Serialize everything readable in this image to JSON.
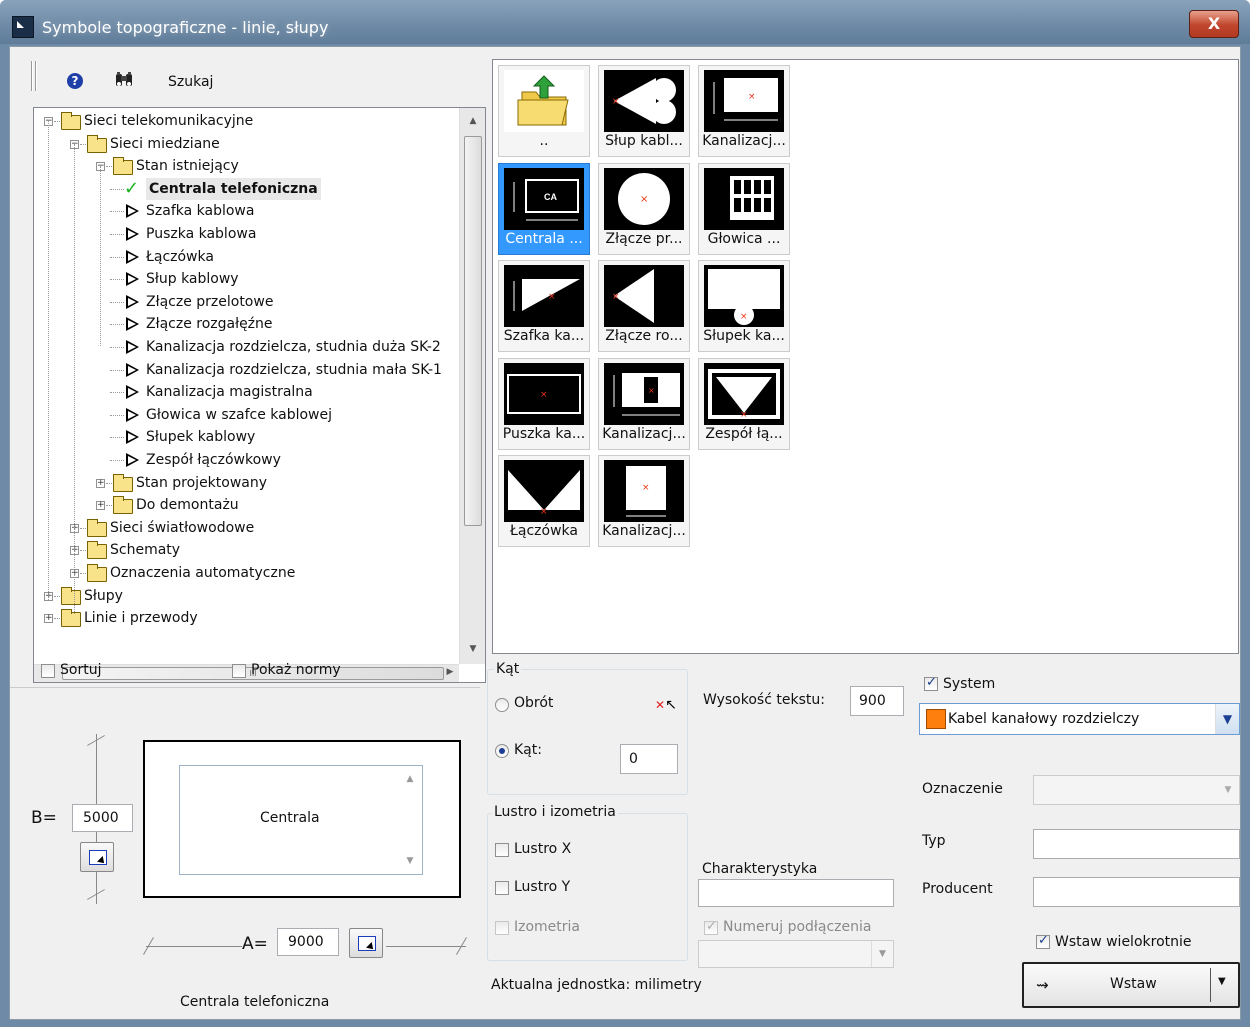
{
  "window": {
    "title": "Symbole topograficzne - linie, słupy",
    "close_label": "X"
  },
  "toolbar": {
    "search_label": "Szukaj",
    "help_label": "?"
  },
  "tree": {
    "items": [
      {
        "label": "Sieci telekomunikacyjne",
        "type": "folder",
        "expanded": true
      },
      {
        "label": "Sieci miedziane",
        "type": "folder",
        "expanded": true
      },
      {
        "label": "Stan istniejący",
        "type": "folder",
        "expanded": true
      },
      {
        "label": "Centrala telefoniczna",
        "type": "symbol",
        "selected": true
      },
      {
        "label": "Szafka kablowa",
        "type": "symbol"
      },
      {
        "label": "Puszka kablowa",
        "type": "symbol"
      },
      {
        "label": "Łączówka",
        "type": "symbol"
      },
      {
        "label": "Słup kablowy",
        "type": "symbol"
      },
      {
        "label": "Złącze przelotowe",
        "type": "symbol"
      },
      {
        "label": "Złącze rozgałęźne",
        "type": "symbol"
      },
      {
        "label": "Kanalizacja rozdzielcza, studnia duża SK-2",
        "type": "symbol"
      },
      {
        "label": "Kanalizacja rozdzielcza, studnia mała SK-1",
        "type": "symbol"
      },
      {
        "label": "Kanalizacja magistralna",
        "type": "symbol"
      },
      {
        "label": "Głowica w szafce kablowej",
        "type": "symbol"
      },
      {
        "label": "Słupek kablowy",
        "type": "symbol"
      },
      {
        "label": "Zespół łączówkowy",
        "type": "symbol"
      },
      {
        "label": "Stan projektowany",
        "type": "folder"
      },
      {
        "label": "Do demontażu",
        "type": "folder"
      },
      {
        "label": "Sieci światłowodowe",
        "type": "folder"
      },
      {
        "label": "Schematy",
        "type": "folder"
      },
      {
        "label": "Oznaczenia automatyczne",
        "type": "folder"
      },
      {
        "label": "Słupy",
        "type": "folder"
      },
      {
        "label": "Linie i przewody",
        "type": "folder"
      }
    ],
    "hscroll_glyph": "III"
  },
  "gallery": {
    "tiles": [
      {
        "caption": "..",
        "icon": "folder-up-icon"
      },
      {
        "caption": "Słup kabl...",
        "icon": "slup-icon"
      },
      {
        "caption": "Kanalizacj...",
        "icon": "kanalizacja-icon"
      },
      {
        "caption": "Centrala ...",
        "icon": "centrala-icon",
        "selected": true
      },
      {
        "caption": "Złącze pr...",
        "icon": "zlacze-przelotowe-icon"
      },
      {
        "caption": "Głowica ...",
        "icon": "glowica-icon"
      },
      {
        "caption": "Szafka ka...",
        "icon": "szafka-icon"
      },
      {
        "caption": "Złącze ro...",
        "icon": "zlacze-rozgalezne-icon"
      },
      {
        "caption": "Słupek ka...",
        "icon": "slupek-icon"
      },
      {
        "caption": "Puszka ka...",
        "icon": "puszka-icon"
      },
      {
        "caption": "Kanalizacj...",
        "icon": "kanalizacja2-icon"
      },
      {
        "caption": "Zespół łą...",
        "icon": "zespol-icon"
      },
      {
        "caption": "Łączówka",
        "icon": "laczowka-icon"
      },
      {
        "caption": "Kanalizacj...",
        "icon": "kanalizacja3-icon"
      }
    ],
    "centrala_text": "CA"
  },
  "options": {
    "sortuj": "Sortuj",
    "pokaz_normy": "Pokaż normy"
  },
  "preview": {
    "b_label": "B=",
    "b_value": "5000",
    "a_label": "A=",
    "a_value": "9000",
    "box_text": "Centrala",
    "caption": "Centrala telefoniczna"
  },
  "angle": {
    "group_label": "Kąt",
    "obrot_label": "Obrót",
    "kat_label": "Kąt:",
    "kat_value": "0"
  },
  "mirror": {
    "group_label": "Lustro i izometria",
    "lustro_x": "Lustro X",
    "lustro_y": "Lustro Y",
    "izometria": "Izometria"
  },
  "text": {
    "height_label": "Wysokość tekstu:",
    "height_value": "900",
    "charakterystyka_label": "Charakterystyka",
    "charakterystyka_value": "",
    "numeruj_label": "Numeruj podłączenia",
    "unit_label": "Aktualna jednostka: milimetry"
  },
  "system": {
    "label": "System",
    "value": "Kabel kanałowy rozdzielczy",
    "color": "#ff7f0e",
    "oznaczenie_label": "Oznaczenie",
    "typ_label": "Typ",
    "producent_label": "Producent",
    "wstaw_wielokrotnie": "Wstaw wielokrotnie",
    "wstaw_label": "Wstaw"
  }
}
